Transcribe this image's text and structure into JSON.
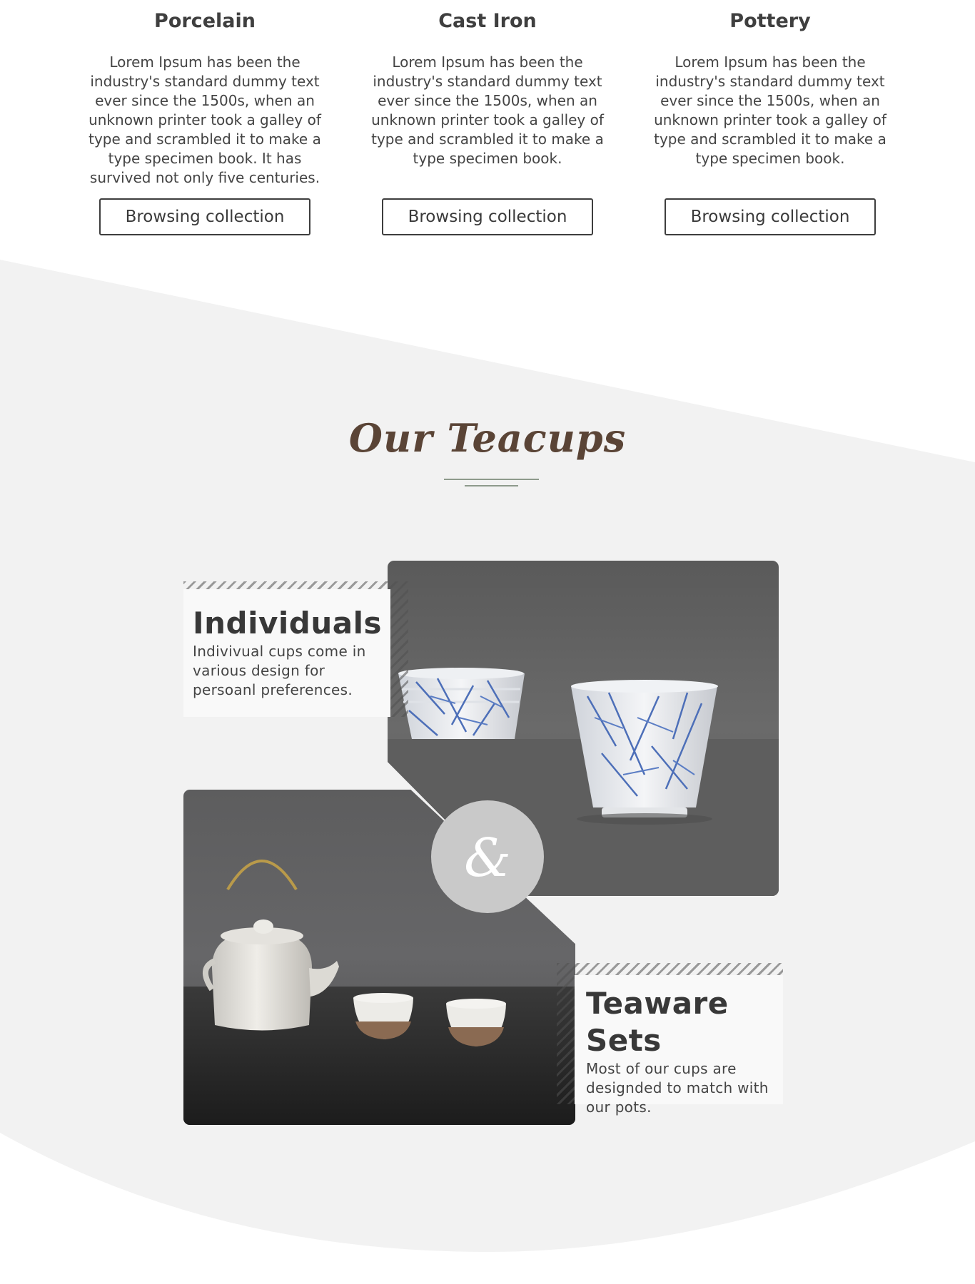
{
  "collections": [
    {
      "title": "Porcelain",
      "text": "Lorem Ipsum has been the industry's standard dummy text ever since the 1500s, when an unknown printer took a galley of type and scrambled it to make a type specimen book. It has survived not only five centuries.",
      "button": "Browsing collection"
    },
    {
      "title": "Cast Iron",
      "text": "Lorem Ipsum has been the industry's standard dummy text ever since the 1500s, when an unknown printer took a galley of type and scrambled it to make a type specimen book.",
      "button": "Browsing collection"
    },
    {
      "title": "Pottery",
      "text": "Lorem Ipsum has been the industry's standard dummy text ever since the 1500s, when an unknown printer took a galley of type and scrambled it to make a type specimen book.",
      "button": "Browsing collection"
    }
  ],
  "teacups": {
    "title": "Our Teacups",
    "individuals": {
      "title": "Individuals",
      "text": "Indivivual cups come in various design for persoanl preferences."
    },
    "sets": {
      "title": "Teaware Sets",
      "text": "Most of our cups are designded to match with our pots."
    },
    "ampersand": "&"
  },
  "colors": {
    "title_brown": "#5a4436",
    "rule_green": "#8e9a8c",
    "section_bg": "#f2f2f2"
  }
}
